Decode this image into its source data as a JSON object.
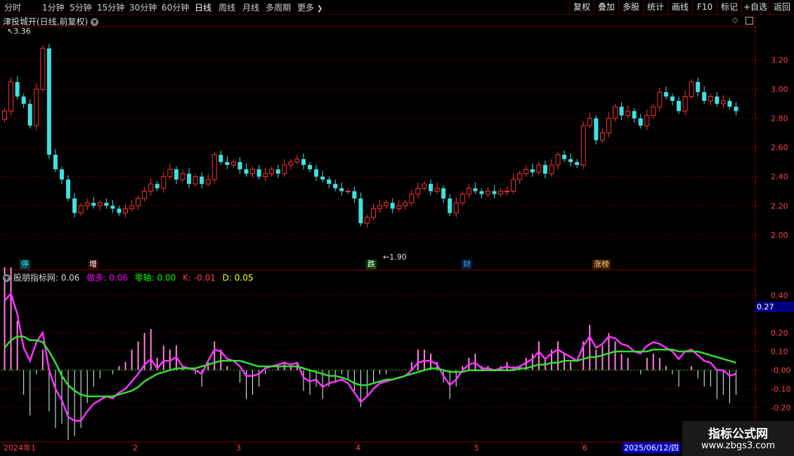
{
  "toolbar": {
    "periods": [
      "分时",
      "1分钟",
      "5分钟",
      "15分钟",
      "30分钟",
      "60分钟",
      "日线",
      "周线",
      "月线",
      "多周期",
      "更多"
    ],
    "more_chevron": "chevron-right-icon",
    "right_buttons": [
      "复权",
      "叠加",
      "多股",
      "统计",
      "画线",
      "F10",
      "标记",
      "+自选",
      "返回"
    ]
  },
  "main": {
    "title": "津投城开(日线,前复权)",
    "high_label": "3.36",
    "low_label": "1.90",
    "price_ticks": [
      "3.20",
      "3.00",
      "2.80",
      "2.60",
      "2.40",
      "2.20",
      "2.00"
    ],
    "event_badges": [
      "停",
      "增",
      "跌",
      "财",
      "涨榜"
    ]
  },
  "indicator": {
    "name": "股朋指标网",
    "value": ": 0.06",
    "series": [
      {
        "label": "做多: 0.06",
        "color": "#ff00ff"
      },
      {
        "label": "零轴: 0.00",
        "color": "#00ff00"
      },
      {
        "label": "K: -0.01",
        "color": "#ff4040"
      },
      {
        "label": "D: 0.05",
        "color": "#ffff00"
      }
    ],
    "ticks": [
      "0.40",
      "0.20",
      "0.10",
      "-0.00",
      "-0.10",
      "-0.20"
    ],
    "current_value": "0.27"
  },
  "date_axis": {
    "labels": [
      "2024年1",
      "2",
      "3",
      "4",
      "5",
      "6"
    ],
    "current_date": "2025/06/12/四"
  },
  "watermark": {
    "line1": "指标公式网",
    "line2": "www.zbgs3.com"
  },
  "colors": {
    "up": "#ff3030",
    "down": "#40e0e0",
    "ma": "#33dd33",
    "osc": "#ff33ff",
    "frame": "#7a0000"
  },
  "chart_data": {
    "type": "candlestick",
    "price_ylim": [
      1.84,
      3.42
    ],
    "closes": [
      2.85,
      3.05,
      2.95,
      2.9,
      2.75,
      3.0,
      3.28,
      2.55,
      2.45,
      2.38,
      2.25,
      2.15,
      2.2,
      2.22,
      2.2,
      2.22,
      2.2,
      2.18,
      2.15,
      2.18,
      2.2,
      2.25,
      2.3,
      2.35,
      2.32,
      2.4,
      2.45,
      2.38,
      2.42,
      2.35,
      2.4,
      2.35,
      2.38,
      2.55,
      2.5,
      2.48,
      2.5,
      2.45,
      2.42,
      2.45,
      2.4,
      2.42,
      2.45,
      2.42,
      2.48,
      2.5,
      2.52,
      2.48,
      2.45,
      2.4,
      2.38,
      2.35,
      2.32,
      2.3,
      2.3,
      2.25,
      2.08,
      2.12,
      2.18,
      2.2,
      2.22,
      2.18,
      2.2,
      2.22,
      2.28,
      2.32,
      2.35,
      2.3,
      2.32,
      2.25,
      2.15,
      2.22,
      2.28,
      2.32,
      2.3,
      2.28,
      2.3,
      2.28,
      2.3,
      2.3,
      2.38,
      2.42,
      2.45,
      2.43,
      2.48,
      2.42,
      2.48,
      2.55,
      2.52,
      2.5,
      2.48,
      2.75,
      2.8,
      2.65,
      2.7,
      2.8,
      2.88,
      2.82,
      2.85,
      2.8,
      2.75,
      2.82,
      2.88,
      2.98,
      2.95,
      2.92,
      2.85,
      2.95,
      3.05,
      2.98,
      2.92,
      2.95,
      2.9,
      2.92,
      2.88,
      2.85
    ],
    "dates": [
      "2024年1",
      "2",
      "3",
      "4",
      "5",
      "6"
    ],
    "indicator_ylim": [
      -0.29,
      0.46
    ],
    "osc": [
      0.37,
      0.41,
      0.3,
      0.12,
      0.05,
      0.15,
      0.2,
      0.0,
      -0.1,
      -0.16,
      -0.25,
      -0.27,
      -0.27,
      -0.22,
      -0.18,
      -0.16,
      -0.14,
      -0.15,
      -0.12,
      -0.1,
      -0.06,
      -0.02,
      0.03,
      0.06,
      0.01,
      0.05,
      0.05,
      0.07,
      0.02,
      0.01,
      0.0,
      -0.02,
      0.05,
      0.11,
      0.1,
      0.06,
      0.05,
      0.02,
      -0.03,
      -0.03,
      -0.02,
      0.01,
      0.02,
      0.03,
      0.04,
      0.03,
      0.04,
      -0.04,
      -0.06,
      -0.05,
      -0.09,
      -0.07,
      -0.06,
      -0.05,
      -0.07,
      -0.12,
      -0.17,
      -0.14,
      -0.1,
      -0.07,
      -0.06,
      -0.05,
      -0.04,
      -0.03,
      0.0,
      0.04,
      0.05,
      0.05,
      0.03,
      -0.03,
      -0.08,
      -0.05,
      0.0,
      0.03,
      0.04,
      0.01,
      0.01,
      0.0,
      0.01,
      0.02,
      0.01,
      0.02,
      0.04,
      0.06,
      0.1,
      0.06,
      0.09,
      0.11,
      0.09,
      0.07,
      0.05,
      0.13,
      0.18,
      0.12,
      0.14,
      0.18,
      0.17,
      0.14,
      0.13,
      0.1,
      0.09,
      0.13,
      0.15,
      0.14,
      0.12,
      0.1,
      0.06,
      0.1,
      0.11,
      0.08,
      0.05,
      0.04,
      0.0,
      0.0,
      -0.03,
      -0.02
    ],
    "ma": [
      0.12,
      0.16,
      0.18,
      0.18,
      0.16,
      0.16,
      0.15,
      0.1,
      0.04,
      -0.03,
      -0.08,
      -0.11,
      -0.13,
      -0.14,
      -0.14,
      -0.14,
      -0.14,
      -0.14,
      -0.13,
      -0.12,
      -0.11,
      -0.09,
      -0.06,
      -0.04,
      -0.02,
      -0.01,
      0.0,
      0.01,
      0.01,
      0.01,
      0.01,
      0.02,
      0.03,
      0.04,
      0.05,
      0.05,
      0.05,
      0.05,
      0.04,
      0.03,
      0.02,
      0.02,
      0.02,
      0.02,
      0.02,
      0.02,
      0.02,
      0.01,
      0.0,
      -0.01,
      -0.02,
      -0.03,
      -0.03,
      -0.04,
      -0.05,
      -0.07,
      -0.08,
      -0.08,
      -0.07,
      -0.06,
      -0.05,
      -0.05,
      -0.04,
      -0.03,
      -0.02,
      -0.01,
      0.0,
      0.01,
      0.01,
      0.0,
      -0.01,
      -0.01,
      -0.01,
      0.0,
      0.0,
      0.0,
      0.0,
      0.0,
      0.0,
      0.0,
      0.0,
      0.01,
      0.01,
      0.02,
      0.03,
      0.03,
      0.04,
      0.04,
      0.05,
      0.05,
      0.05,
      0.06,
      0.07,
      0.07,
      0.08,
      0.09,
      0.1,
      0.1,
      0.1,
      0.1,
      0.1,
      0.1,
      0.11,
      0.11,
      0.11,
      0.11,
      0.1,
      0.1,
      0.1,
      0.1,
      0.09,
      0.08,
      0.07,
      0.06,
      0.05,
      0.04
    ]
  }
}
